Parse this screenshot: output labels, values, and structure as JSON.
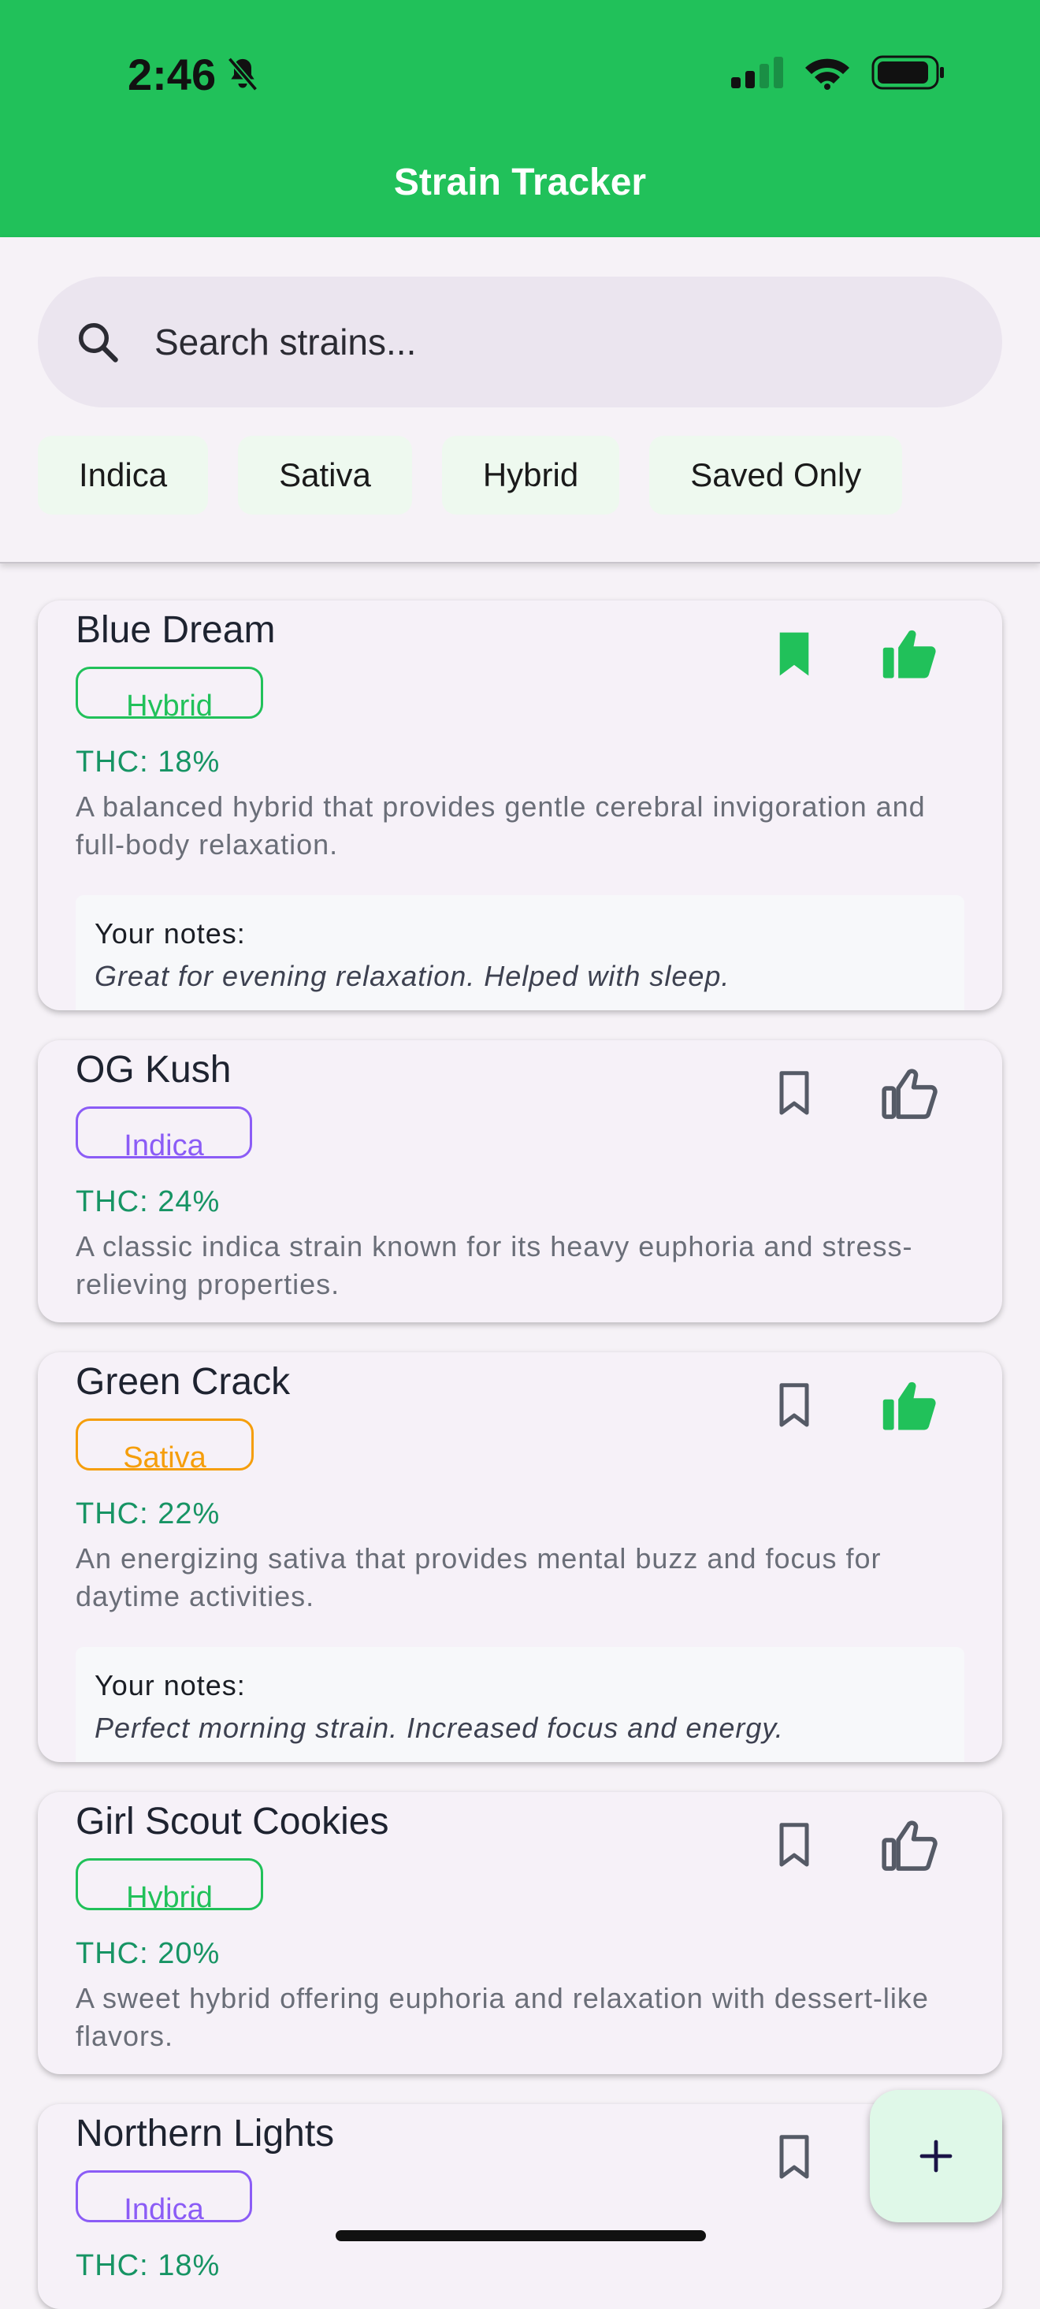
{
  "status_bar": {
    "time": "2:46"
  },
  "app_bar": {
    "title": "Strain Tracker"
  },
  "search": {
    "placeholder": "Search strains..."
  },
  "filters": [
    "Indica",
    "Sativa",
    "Hybrid",
    "Saved Only"
  ],
  "colors": {
    "primary": "#21c15a",
    "hybrid": "#21c15a",
    "indica": "#8b5cf6",
    "sativa": "#f59e0b",
    "thc_text": "#179464"
  },
  "strains": [
    {
      "name": "Blue Dream",
      "type": "Hybrid",
      "thc": "THC: 18%",
      "description": "A balanced hybrid that provides gentle cerebral invigoration and full-body relaxation.",
      "saved": true,
      "liked": true,
      "notes_label": "Your notes:",
      "notes": "Great for evening relaxation. Helped with sleep."
    },
    {
      "name": "OG Kush",
      "type": "Indica",
      "thc": "THC: 24%",
      "description": "A classic indica strain known for its heavy euphoria and stress-relieving properties.",
      "saved": false,
      "liked": false
    },
    {
      "name": "Green Crack",
      "type": "Sativa",
      "thc": "THC: 22%",
      "description": "An energizing sativa that provides mental buzz and focus for daytime activities.",
      "saved": false,
      "liked": true,
      "notes_label": "Your notes:",
      "notes": "Perfect morning strain. Increased focus and energy."
    },
    {
      "name": "Girl Scout Cookies",
      "type": "Hybrid",
      "thc": "THC: 20%",
      "description": "A sweet hybrid offering euphoria and relaxation with dessert-like flavors.",
      "saved": false,
      "liked": false
    },
    {
      "name": "Northern Lights",
      "type": "Indica",
      "thc": "THC: 18%",
      "saved": false,
      "liked": false
    }
  ],
  "fab": {
    "icon": "plus-icon"
  }
}
